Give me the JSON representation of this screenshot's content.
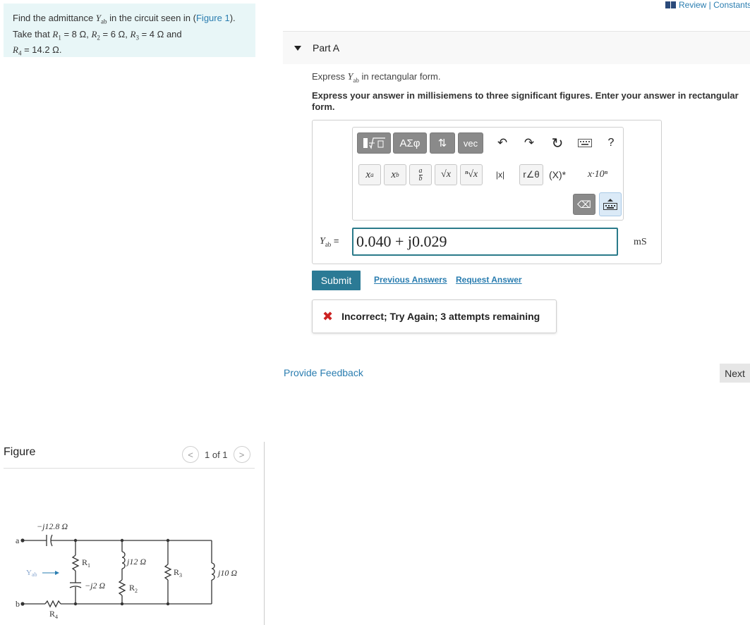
{
  "problem": {
    "line1_pre": "Find the admittance ",
    "Y": "Y",
    "ab": "ab",
    "line1_mid": " in the circuit seen in (",
    "figure_link": "Figure 1",
    "line1_post": ").",
    "line2_pre": "Take that ",
    "R": "R",
    "r1_sub": "1",
    "r1_val": " = 8 Ω, ",
    "r2_sub": "2",
    "r2_val": " = 6 Ω, ",
    "r3_sub": "3",
    "r3_val": " = 4 Ω and",
    "r4_sub": "4",
    "r4_val": " = 14.2 Ω."
  },
  "figure": {
    "title": "Figure",
    "pager": "1 of 1",
    "prev": "<",
    "next": ">",
    "labels": {
      "cap_top": "−j12.8 Ω",
      "node_a": "a",
      "node_b": "b",
      "yab": "Y",
      "yab_sub": "ab",
      "r1": "R",
      "r1_sub": "1",
      "cap_mid": "−j2 Ω",
      "ind1": "j12 Ω",
      "r2": "R",
      "r2_sub": "2",
      "r3": "R",
      "r3_sub": "3",
      "ind2": "j10 Ω",
      "r4": "R",
      "r4_sub": "4"
    }
  },
  "header": {
    "review": "Review | Constants",
    "part": "Part A"
  },
  "instructions": {
    "line1_pre": "Express ",
    "line1_post": " in rectangular form.",
    "line2": "Express your answer in millisiemens to three significant figures. Enter your answer in rectangular form."
  },
  "toolbar": {
    "greek": "ΑΣφ",
    "updown": "⇅",
    "vec": "vec",
    "undo": "↶",
    "redo": "↷",
    "reset": "↻",
    "help": "?",
    "xa": "x",
    "xa_sup": "a",
    "xb": "x",
    "xb_sub": "b",
    "frac_num": "a",
    "frac_den": "b",
    "sqrt": "√x",
    "nroot": "ⁿ√x",
    "abs": "|x|",
    "polar": "r∠θ",
    "conj": "(X)*",
    "sci": "x·10ⁿ",
    "backspace": "⌫"
  },
  "answer": {
    "label_Y": "Y",
    "label_sub": "ab",
    "label_eq": " =",
    "value": "0.040 + j0.029",
    "unit": "mS"
  },
  "actions": {
    "submit": "Submit",
    "previous": "Previous Answers",
    "request": "Request Answer"
  },
  "feedback": {
    "icon": "✖",
    "message": "Incorrect; Try Again; 3 attempts remaining"
  },
  "footer": {
    "provide_feedback": "Provide Feedback",
    "next": "Next"
  },
  "colors": {
    "accent": "#2b7a95",
    "link": "#2a7db0",
    "problem_bg": "#e8f6f7",
    "error": "#cc2222"
  }
}
